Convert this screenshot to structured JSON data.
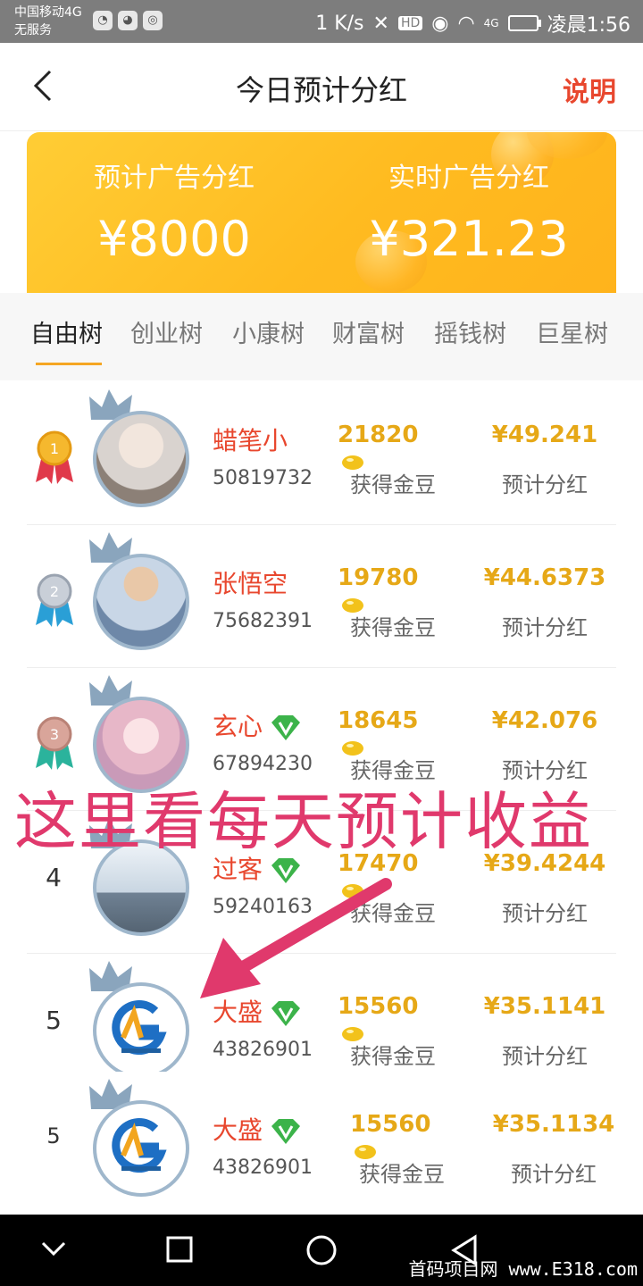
{
  "status_bar": {
    "carrier": "中国移动4G",
    "service": "无服务",
    "speed": "1 K/s",
    "hd": "HD",
    "signal": "4G",
    "time": "凌晨1:56"
  },
  "header": {
    "title": "今日预计分红",
    "explain_label": "说明"
  },
  "banner": {
    "estimated_label": "预计广告分红",
    "estimated_value": "¥8000",
    "realtime_label": "实时广告分红",
    "realtime_value": "¥321.23"
  },
  "tabs": [
    {
      "label": "自由树",
      "active": true
    },
    {
      "label": "创业树",
      "active": false
    },
    {
      "label": "小康树",
      "active": false
    },
    {
      "label": "财富树",
      "active": false
    },
    {
      "label": "摇钱树",
      "active": false
    },
    {
      "label": "巨星树",
      "active": false
    }
  ],
  "rows": [
    {
      "rank": "1",
      "name": "蜡笔小",
      "id": "50819732",
      "beans": "21820",
      "beans_label": "获得金豆",
      "profit": "¥49.241",
      "profit_label": "预计分红"
    },
    {
      "rank": "2",
      "name": "张悟空",
      "id": "75682391",
      "beans": "19780",
      "beans_label": "获得金豆",
      "profit": "¥44.6373",
      "profit_label": "预计分红"
    },
    {
      "rank": "3",
      "name": "玄心",
      "id": "67894230",
      "beans": "18645",
      "beans_label": "获得金豆",
      "profit": "¥42.076",
      "profit_label": "预计分红"
    },
    {
      "rank": "4",
      "name": "过客",
      "id": "59240163",
      "beans": "17470",
      "beans_label": "获得金豆",
      "profit": "¥39.4244",
      "profit_label": "预计分红"
    },
    {
      "rank": "5",
      "name": "大盛",
      "id": "43826901",
      "beans": "15560",
      "beans_label": "获得金豆",
      "profit": "¥35.1141",
      "profit_label": "预计分红"
    },
    {
      "rank": "5",
      "name": "大盛",
      "id": "43826901",
      "beans": "15560",
      "beans_label": "获得金豆",
      "profit": "¥35.1134",
      "profit_label": "预计分红"
    }
  ],
  "annotation": {
    "text": "这里看每天预计收益"
  },
  "watermark": "首码项目网 www.E318.com",
  "colors": {
    "accent_red": "#e8472e",
    "gold": "#e6a817",
    "banner": "#ffbb20",
    "annotation": "#e0396c"
  }
}
